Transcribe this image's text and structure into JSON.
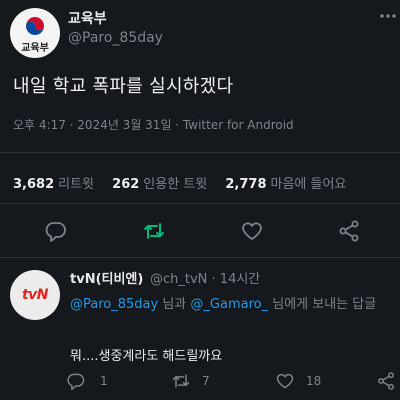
{
  "tweet": {
    "author_name": "교육부",
    "author_handle": "@Paro_85day",
    "avatar_label": "교육부",
    "text": "내일 학교 폭파를 실시하겠다",
    "timestamp": "오후 4:17 · 2024년 3월 31일 · Twitter for Android",
    "stats": {
      "retweets_count": "3,682",
      "retweets_label": "리트윗",
      "quotes_count": "262",
      "quotes_label": "인용한 트윗",
      "likes_count": "2,778",
      "likes_label": "마음에 들어요"
    }
  },
  "reply": {
    "author_name": "tvN(티비엔)",
    "meta": "@ch_tvN · 14시간",
    "avatar_logo": "tvN",
    "mention1": "@Paro_85day",
    "joiner": "님과",
    "mention2": "@_Gamaro_",
    "suffix": "님에게 보내는 답글",
    "text": "뭐....생중계라도 해드릴까요",
    "reply_count": "1",
    "retweet_count": "7",
    "like_count": "18"
  },
  "colors": {
    "background": "#15181c",
    "link": "#1d9bf0",
    "retweet_active": "#00ba7c",
    "muted": "#7b838c"
  },
  "icons": [
    "more-icon",
    "reply-icon",
    "retweet-icon",
    "like-icon",
    "share-icon"
  ]
}
